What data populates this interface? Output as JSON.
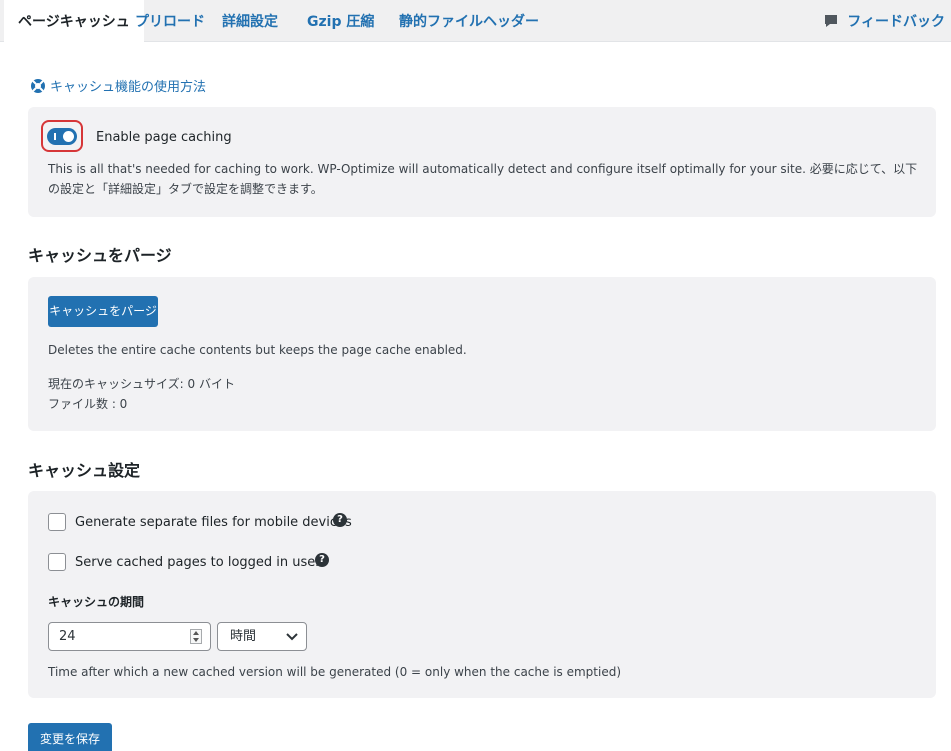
{
  "tabs": [
    {
      "label": "ページキャッシュ",
      "active": true
    },
    {
      "label": "プリロード"
    },
    {
      "label": "詳細設定"
    },
    {
      "label": "Gzip 圧縮"
    },
    {
      "label": "静的ファイルヘッダー"
    }
  ],
  "feedback_label": "フィードバック",
  "howto_link": "キャッシュ機能の使用方法",
  "enable": {
    "label": "Enable page caching",
    "enabled": true,
    "description": "This is all that's needed for caching to work. WP-Optimize will automatically detect and configure itself optimally for your site. 必要に応じて、以下の設定と「詳細設定」タブで設定を調整できます。"
  },
  "purge": {
    "heading": "キャッシュをパージ",
    "button": "キャッシュをパージ",
    "description": "Deletes the entire cache contents but keeps the page cache enabled.",
    "cache_size": "現在のキャッシュサイズ: 0 バイト",
    "file_count": "ファイル数 : 0"
  },
  "settings": {
    "heading": "キャッシュ設定",
    "mobile_label": "Generate separate files for mobile devices",
    "mobile_checked": false,
    "logged_in_label": "Serve cached pages to logged in users",
    "logged_in_checked": false,
    "help_glyph": "?",
    "duration_label": "キャッシュの期間",
    "duration_value": "24",
    "duration_unit": "時間",
    "duration_help": "Time after which a new cached version will be generated (0 = only when the cache is emptied)"
  },
  "save_button": "変更を保存",
  "colors": {
    "accent": "#2271b1",
    "highlight": "#d63638",
    "panel": "#f2f2f4"
  }
}
